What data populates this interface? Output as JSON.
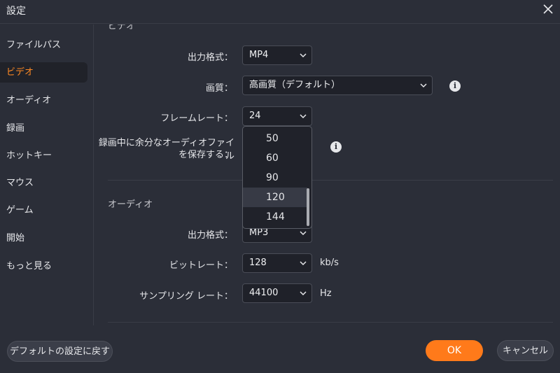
{
  "window": {
    "title": "設定"
  },
  "sidebar": {
    "items": [
      {
        "label": "ファイルパス"
      },
      {
        "label": "ビデオ",
        "active": true
      },
      {
        "label": "オーディオ"
      },
      {
        "label": "録画"
      },
      {
        "label": "ホットキー"
      },
      {
        "label": "マウス"
      },
      {
        "label": "ゲーム"
      },
      {
        "label": "開始"
      },
      {
        "label": "もっと見る"
      }
    ]
  },
  "video": {
    "section_title_partial": "ビデオ",
    "format": {
      "label": "出力格式：",
      "value": "MP4"
    },
    "quality": {
      "label": "画質：",
      "value": "高画質（デフォルト）"
    },
    "framerate": {
      "label": "フレームレート：",
      "value": "24"
    },
    "save_extra_audio": {
      "label_line1": "録画中に余分なオーディオファイル",
      "label_line2": "を保存する："
    },
    "framerate_options": [
      "50",
      "60",
      "90",
      "120",
      "144"
    ],
    "framerate_hover": "120"
  },
  "audio": {
    "section_title": "オーディオ",
    "format": {
      "label": "出力格式：",
      "value": "MP3"
    },
    "bitrate": {
      "label": "ビットレート：",
      "value": "128",
      "unit": "kb/s"
    },
    "sample_rate": {
      "label": "サンプリング レート：",
      "value": "44100",
      "unit": "Hz"
    }
  },
  "footer": {
    "reset_label": "デフォルトの設定に戻す",
    "ok_label": "OK",
    "cancel_label": "キャンセル"
  },
  "colors": {
    "accent": "#ff7a1a",
    "active_text": "#ff8a24",
    "background": "#2b2e38"
  },
  "icons": {
    "close": "close-icon",
    "chevron": "chevron-down-icon",
    "info": "info-icon"
  }
}
